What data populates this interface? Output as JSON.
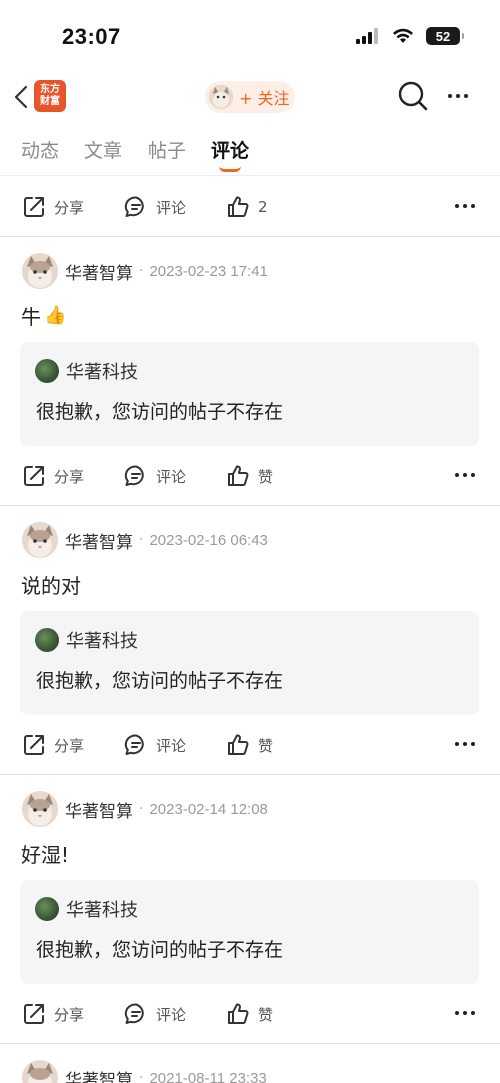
{
  "status_bar": {
    "time": "23:07",
    "battery": "52"
  },
  "nav": {
    "logo_line1": "东方",
    "logo_line2": "财富",
    "follow_label": "+ 关注"
  },
  "tabs": [
    {
      "label": "动态"
    },
    {
      "label": "文章"
    },
    {
      "label": "帖子"
    },
    {
      "label": "评论"
    }
  ],
  "active_tab": "评论",
  "top_actions": {
    "share": "分享",
    "comment": "评论",
    "like": "2"
  },
  "posts": [
    {
      "author": "华著智算",
      "date": "2023-02-23 17:41",
      "text": "牛",
      "emoji": "👍",
      "quote_author": "华著科技",
      "quote_text": "很抱歉，您访问的帖子不存在",
      "share": "分享",
      "comment": "评论",
      "like": "赞"
    },
    {
      "author": "华著智算",
      "date": "2023-02-16 06:43",
      "text": "说的对",
      "quote_author": "华著科技",
      "quote_text": "很抱歉，您访问的帖子不存在",
      "share": "分享",
      "comment": "评论",
      "like": "赞"
    },
    {
      "author": "华著智算",
      "date": "2023-02-14 12:08",
      "text": "好湿!",
      "quote_author": "华著科技",
      "quote_text": "很抱歉，您访问的帖子不存在",
      "share": "分享",
      "comment": "评论",
      "like": "赞"
    },
    {
      "author": "华著智算",
      "date": "2021-08-11 23:33"
    }
  ],
  "colors": {
    "accent": "#f26522",
    "logo": "#e8552c",
    "card": "#f5f5f7"
  }
}
